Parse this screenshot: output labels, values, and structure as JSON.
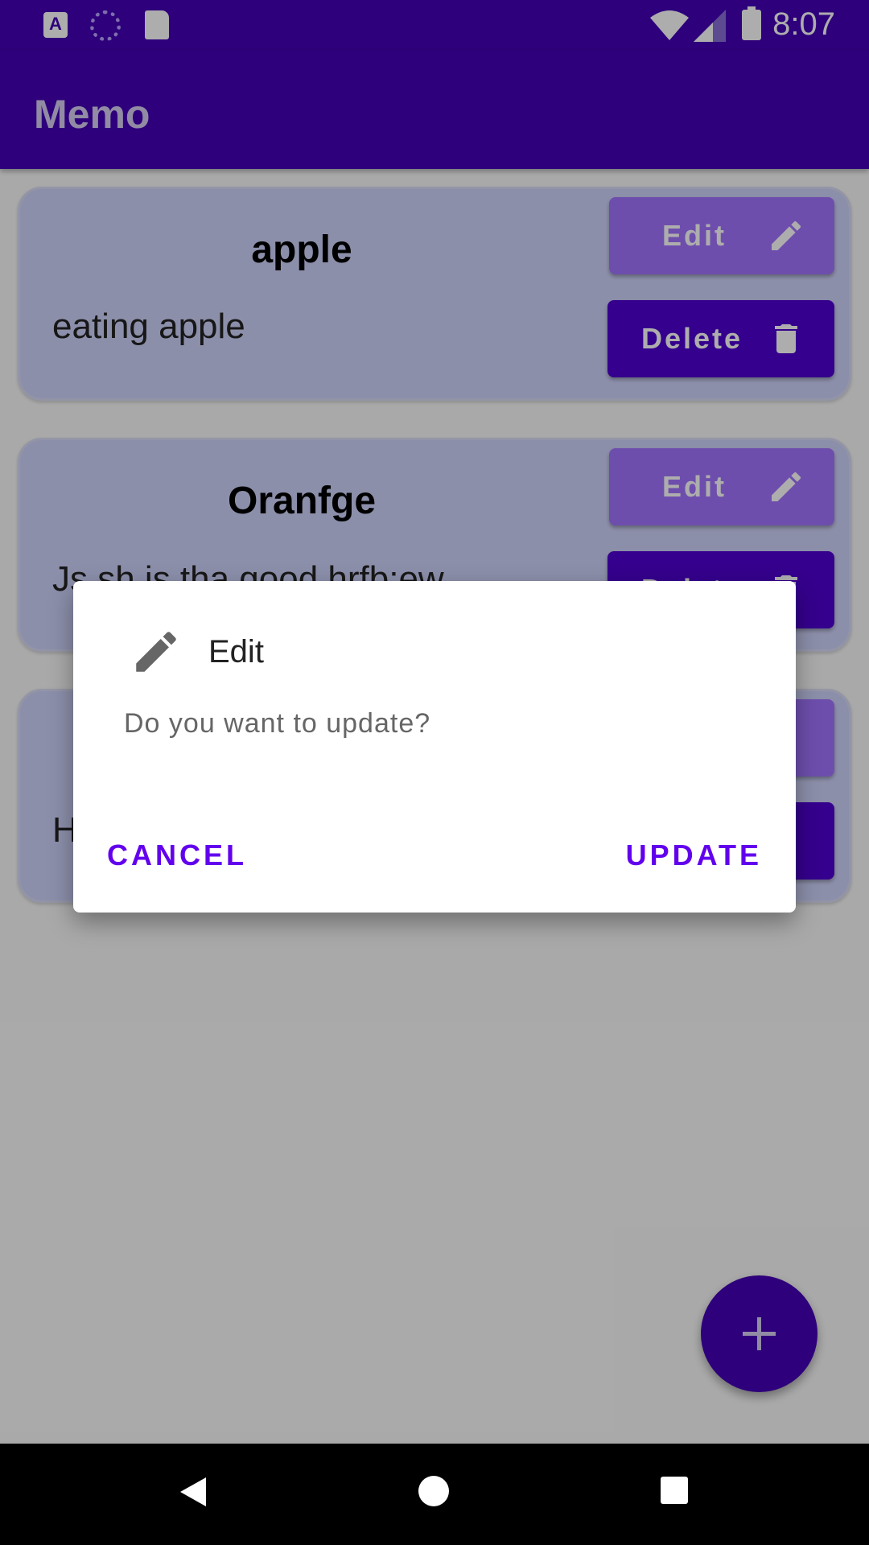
{
  "status_bar": {
    "time": "8:07",
    "left_icons": [
      "app-notification-icon",
      "sync-spinner-icon",
      "sd-card-icon"
    ],
    "right_icons": [
      "wifi-icon",
      "cellular-signal-icon",
      "battery-icon"
    ]
  },
  "app_bar": {
    "title": "Memo"
  },
  "memos": [
    {
      "title": "apple",
      "body": "eating apple",
      "edit_label": "Edit",
      "delete_label": "Delete"
    },
    {
      "title": "Oranfge",
      "body": "Js sh is tha good hrfb;ew",
      "edit_label": "Edit",
      "delete_label": "Delete"
    },
    {
      "title": "",
      "body": "H",
      "edit_label": "",
      "delete_label": ""
    }
  ],
  "dialog": {
    "icon": "pencil-icon",
    "title": "Edit",
    "message": "Do you want to update?",
    "cancel_label": "CANCEL",
    "confirm_label": "UPDATE"
  },
  "fab": {
    "icon": "plus-icon"
  },
  "nav_bar": {
    "icons": [
      "back-icon",
      "home-icon",
      "recent-apps-icon"
    ]
  },
  "colors": {
    "primary": "#4500b5",
    "accent": "#6200ee",
    "edit_button": "#a374ff",
    "delete_button": "#4f00d0",
    "card": "#cfd3fb"
  }
}
